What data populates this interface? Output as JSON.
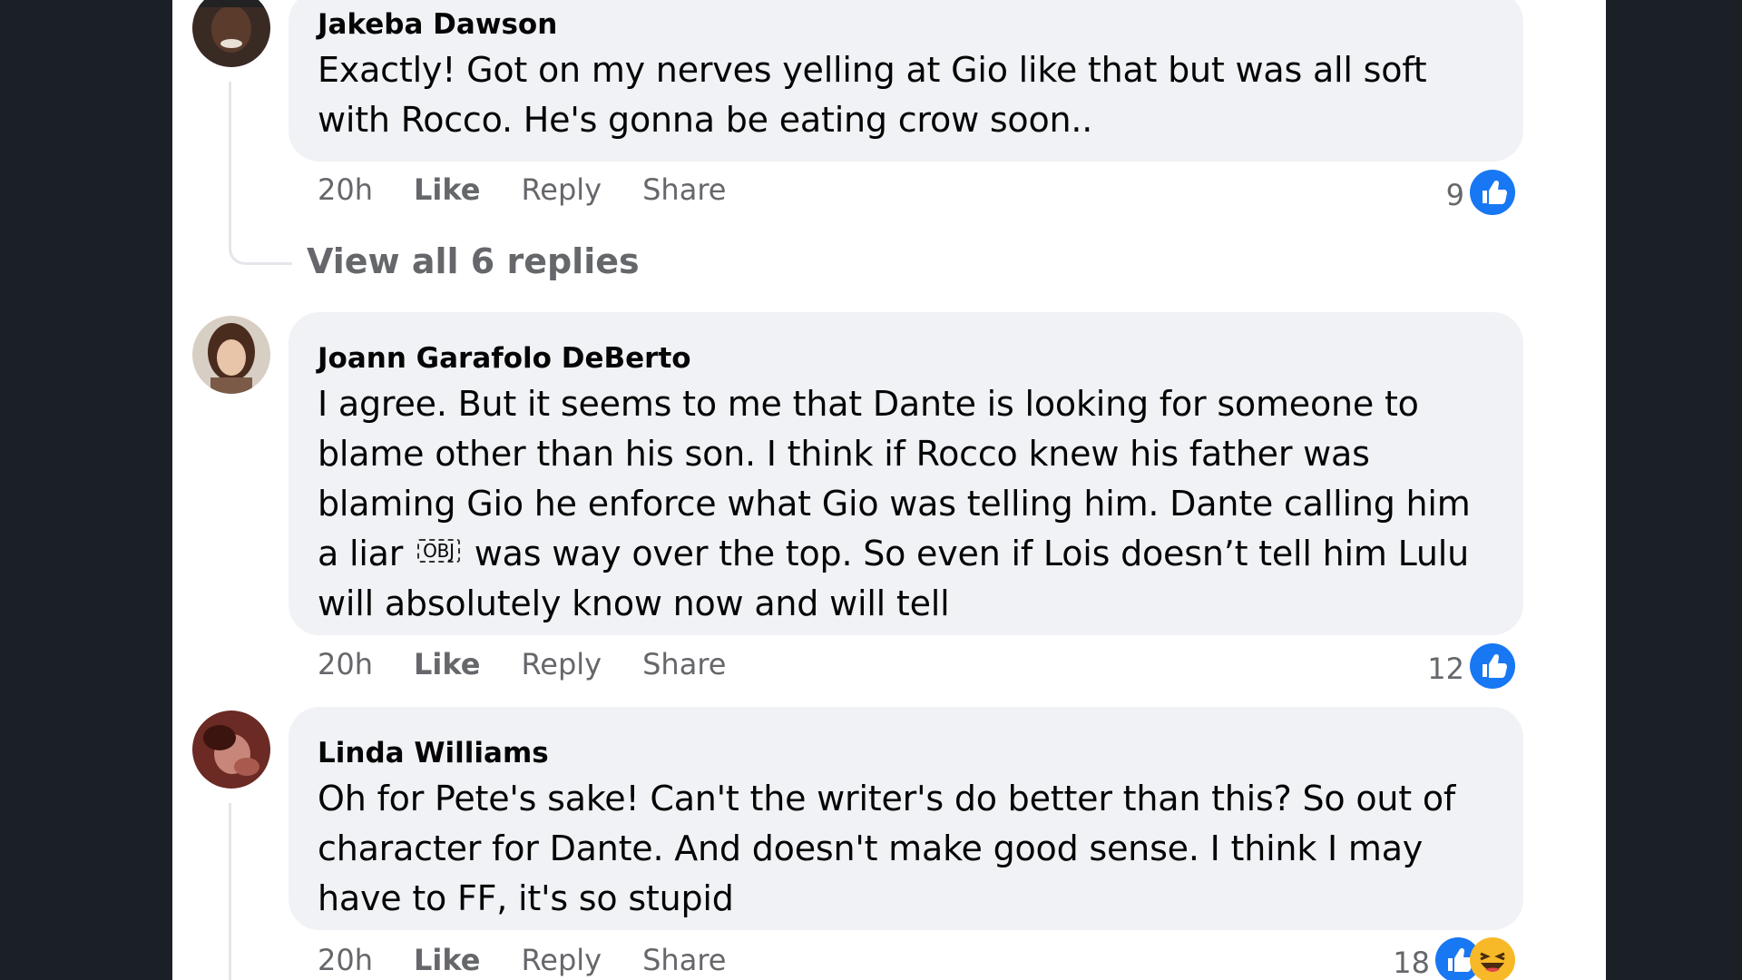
{
  "comments": [
    {
      "author": "Jakeba Dawson",
      "text": "Exactly! Got on my nerves yelling at Gio like that but was all soft with Rocco. He's gonna be eating crow soon..",
      "time": "20h",
      "like_label": "Like",
      "reply_label": "Reply",
      "share_label": "Share",
      "reaction_count": "9",
      "reactions": [
        "like-icon"
      ]
    },
    {
      "author": "Joann Garafolo DeBerto",
      "text_before": "I agree. But it seems to me that Dante is looking for someone to blame other than his son. I think if Rocco knew his father was blaming Gio he enforce what Gio was telling him. Dante calling him a liar",
      "obj_glyph": "OBJ",
      "text_after": "was way over the top. So even if Lois doesn’t tell him Lulu will absolutely know now and will tell",
      "time": "20h",
      "like_label": "Like",
      "reply_label": "Reply",
      "share_label": "Share",
      "reaction_count": "12",
      "reactions": [
        "like-icon"
      ]
    },
    {
      "author": "Linda Williams",
      "text": "Oh for Pete's sake! Can't the writer's do better than this? So out of character for Dante. And doesn't make good sense. I think I may have to FF, it's so stupid",
      "time": "20h",
      "like_label": "Like",
      "reply_label": "Reply",
      "share_label": "Share",
      "reaction_count": "18",
      "reactions": [
        "like-icon",
        "laugh-icon"
      ]
    }
  ],
  "view_replies_label": "View all 6 replies",
  "colors": {
    "bubble": "#f0f2f5",
    "like_blue": "#1877f2",
    "meta_gray": "#65676b",
    "backdrop": "#1b2027"
  }
}
